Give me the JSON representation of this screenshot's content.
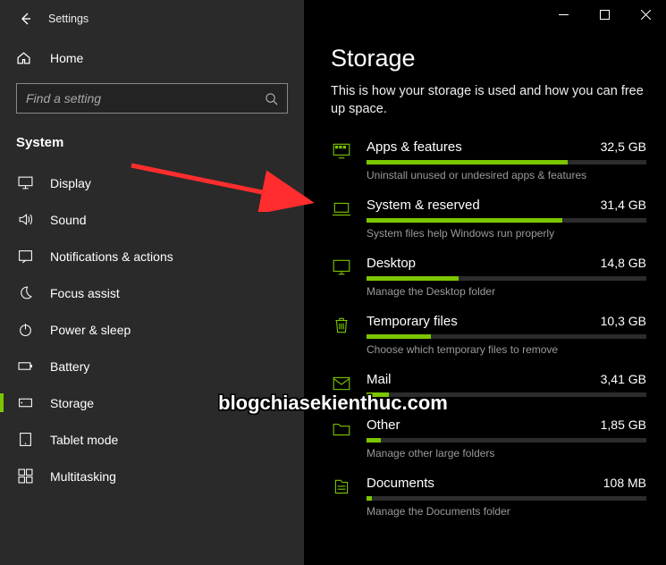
{
  "titlebar": {
    "title": "Settings"
  },
  "home_label": "Home",
  "search": {
    "placeholder": "Find a setting"
  },
  "section_label": "System",
  "nav": [
    {
      "label": "Display",
      "icon": "display"
    },
    {
      "label": "Sound",
      "icon": "sound"
    },
    {
      "label": "Notifications & actions",
      "icon": "notifications"
    },
    {
      "label": "Focus assist",
      "icon": "moon"
    },
    {
      "label": "Power & sleep",
      "icon": "power"
    },
    {
      "label": "Battery",
      "icon": "battery"
    },
    {
      "label": "Storage",
      "icon": "storage",
      "active": true
    },
    {
      "label": "Tablet mode",
      "icon": "tablet"
    },
    {
      "label": "Multitasking",
      "icon": "multitask"
    }
  ],
  "page": {
    "title": "Storage",
    "description": "This is how your storage is used and how you can free up space."
  },
  "storage": [
    {
      "icon": "apps",
      "name": "Apps & features",
      "size": "32,5 GB",
      "fill": 72,
      "sub": "Uninstall unused or undesired apps & features"
    },
    {
      "icon": "laptop",
      "name": "System & reserved",
      "size": "31,4 GB",
      "fill": 70,
      "sub": "System files help Windows run properly"
    },
    {
      "icon": "desktop",
      "name": "Desktop",
      "size": "14,8 GB",
      "fill": 33,
      "sub": "Manage the Desktop folder"
    },
    {
      "icon": "trash",
      "name": "Temporary files",
      "size": "10,3 GB",
      "fill": 23,
      "sub": "Choose which temporary files to remove"
    },
    {
      "icon": "mail",
      "name": "Mail",
      "size": "3,41 GB",
      "fill": 8,
      "sub": ""
    },
    {
      "icon": "folder",
      "name": "Other",
      "size": "1,85 GB",
      "fill": 5,
      "sub": "Manage other large folders"
    },
    {
      "icon": "documents",
      "name": "Documents",
      "size": "108 MB",
      "fill": 2,
      "sub": "Manage the Documents folder"
    }
  ],
  "watermark": "blogchiasekienthuc.com"
}
